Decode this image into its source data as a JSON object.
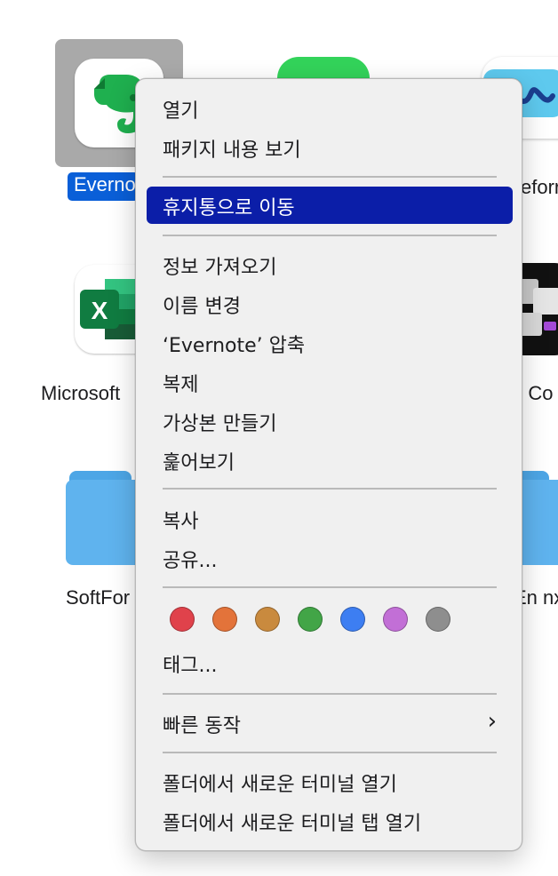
{
  "desktop": {
    "icons": [
      {
        "label": "Evernote",
        "selected": true
      },
      {
        "label": "Microsoft"
      },
      {
        "label": "SoftFor"
      },
      {
        "label": "eforr"
      },
      {
        "label": "n Co"
      },
      {
        "label": "En nx"
      }
    ]
  },
  "menu": {
    "group1": [
      "열기",
      "패키지 내용 보기"
    ],
    "trash": "휴지통으로 이동",
    "group3": [
      "정보 가져오기",
      "이름 변경",
      "‘Evernote’ 압축",
      "복제",
      "가상본 만들기",
      "훑어보기"
    ],
    "group4": [
      "복사",
      "공유..."
    ],
    "tag_colors": [
      "#e0424b",
      "#e3733a",
      "#c98a3e",
      "#42a547",
      "#3d7ef2",
      "#c26fd6",
      "#8e8e8e"
    ],
    "tags_label": "태그...",
    "quick_actions": "빠른 동작",
    "quick_actions_icon": "chevron-right-icon",
    "services": [
      "폴더에서 새로운 터미널 열기",
      "폴더에서 새로운 터미널 탭 열기"
    ]
  }
}
